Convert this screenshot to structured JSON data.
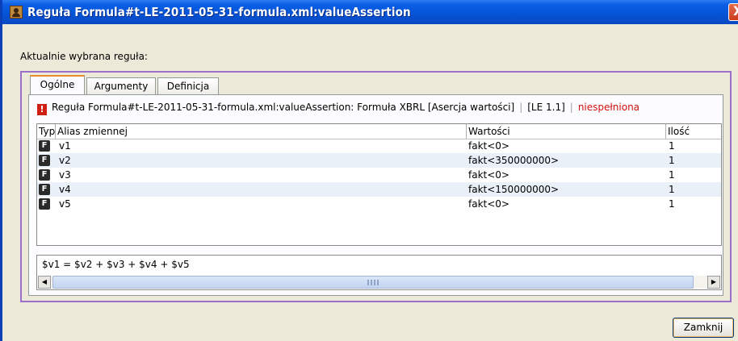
{
  "window": {
    "title": "Reguła Formula#t-LE-2011-05-31-formula.xml:valueAssertion",
    "close_glyph": "X"
  },
  "selected_rule_label": "Aktualnie wybrana reguła:",
  "tabs": [
    {
      "label": "Ogólne",
      "active": true
    },
    {
      "label": "Argumenty",
      "active": false
    },
    {
      "label": "Definicja",
      "active": false
    }
  ],
  "rule_info": {
    "warning_glyph": "!",
    "description": "Reguła Formula#t-LE-2011-05-31-formula.xml:valueAssertion: Formuła XBRL [Asercja wartości]",
    "version": "[LE 1.1]",
    "status": "niespełniona",
    "status_color": "#d01010"
  },
  "table": {
    "columns": [
      "Typ",
      "Alias zmiennej",
      "Wartości",
      "Ilość"
    ],
    "type_icon_glyph": "F",
    "rows": [
      {
        "alias": "v1",
        "value": "fakt<0>",
        "count": "1"
      },
      {
        "alias": "v2",
        "value": "fakt<350000000>",
        "count": "1"
      },
      {
        "alias": "v3",
        "value": "fakt<0>",
        "count": "1"
      },
      {
        "alias": "v4",
        "value": "fakt<150000000>",
        "count": "1"
      },
      {
        "alias": "v5",
        "value": "fakt<0>",
        "count": "1"
      }
    ]
  },
  "formula": {
    "expression": "$v1 = $v2 + $v3 + $v4 + $v5",
    "scroll_left": "◀",
    "scroll_right": "▶"
  },
  "footer": {
    "close_label": "Zamknij"
  },
  "colors": {
    "titlebar": "#0553d6",
    "panel_border": "#9b6fc9",
    "alt_row": "#e9f0f8"
  }
}
